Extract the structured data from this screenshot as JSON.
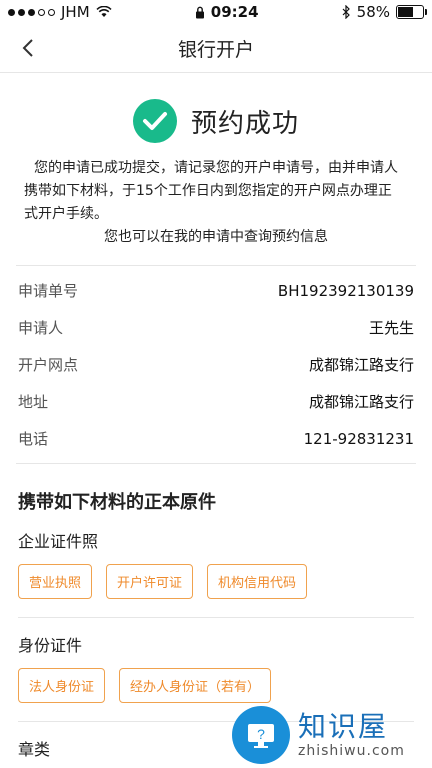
{
  "status_bar": {
    "carrier": "JHM",
    "time": "09:24",
    "battery_percent": "58%",
    "battery_level": 0.58
  },
  "nav": {
    "title": "银行开户"
  },
  "success": {
    "title": "预约成功"
  },
  "notice": {
    "line1": "您的申请已成功提交，请记录您的开户申请号，由并申请人",
    "line2": "携带如下材料，于15个工作日内到您指定的开户网点办理正",
    "line3": "式开户手续。",
    "line4": "您也可以在我的申请中查询预约信息"
  },
  "info_rows": [
    {
      "label": "申请单号",
      "value": "BH192392130139"
    },
    {
      "label": "申请人",
      "value": "王先生"
    },
    {
      "label": "开户网点",
      "value": "成都锦江路支行"
    },
    {
      "label": "地址",
      "value": "成都锦江路支行"
    },
    {
      "label": "电话",
      "value": "121-92831231"
    }
  ],
  "materials": {
    "title": "携带如下材料的正本原件",
    "groups": [
      {
        "title": "企业证件照",
        "tags": [
          "营业执照",
          "开户许可证",
          "机构信用代码"
        ]
      },
      {
        "title": "身份证件",
        "tags": [
          "法人身份证",
          "经办人身份证（若有）"
        ]
      },
      {
        "title": "章类",
        "tags": []
      }
    ]
  },
  "watermark": {
    "cn": "知识屋",
    "en": "zhishiwu.com"
  }
}
